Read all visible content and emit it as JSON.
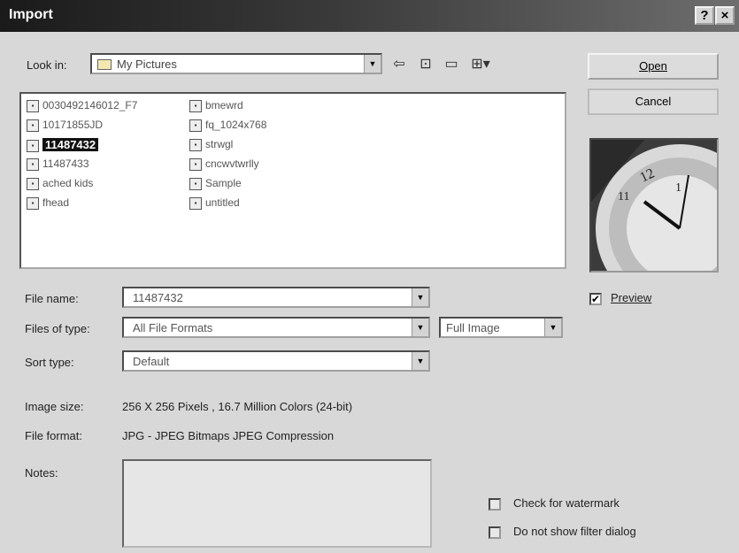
{
  "window": {
    "title": "Import",
    "help_glyph": "?",
    "close_glyph": "×"
  },
  "lookin": {
    "label": "Look in:",
    "value": "My Pictures"
  },
  "toolbar_icons": [
    "back-icon",
    "up-folder-icon",
    "new-folder-icon",
    "view-menu-icon"
  ],
  "buttons": {
    "open": "Open",
    "cancel": "Cancel"
  },
  "files": [
    "0030492146012_F7",
    "10171855JD",
    "11487432",
    "11487433",
    "ached kids",
    "fhead",
    "bmewrd",
    "fq_1024x768",
    "strwgl",
    "cncwvtwrlly",
    "Sample",
    "untitled"
  ],
  "selected_file": "11487432",
  "fields": {
    "file_name_label": "File name:",
    "file_name_value": "11487432",
    "files_of_type_label": "Files of type:",
    "files_of_type_value": "All File Formats",
    "image_mode_value": "Full Image",
    "sort_type_label": "Sort type:",
    "sort_type_value": "Default",
    "image_size_label": "Image size:",
    "image_size_value": "256 X 256 Pixels , 16.7 Million Colors (24-bit)",
    "file_format_label": "File format:",
    "file_format_value": "JPG - JPEG Bitmaps JPEG Compression",
    "notes_label": "Notes:"
  },
  "preview": {
    "label": "Preview",
    "checked": true
  },
  "options": {
    "check_watermark": "Check for watermark",
    "no_filter_dialog": "Do not show filter dialog"
  }
}
